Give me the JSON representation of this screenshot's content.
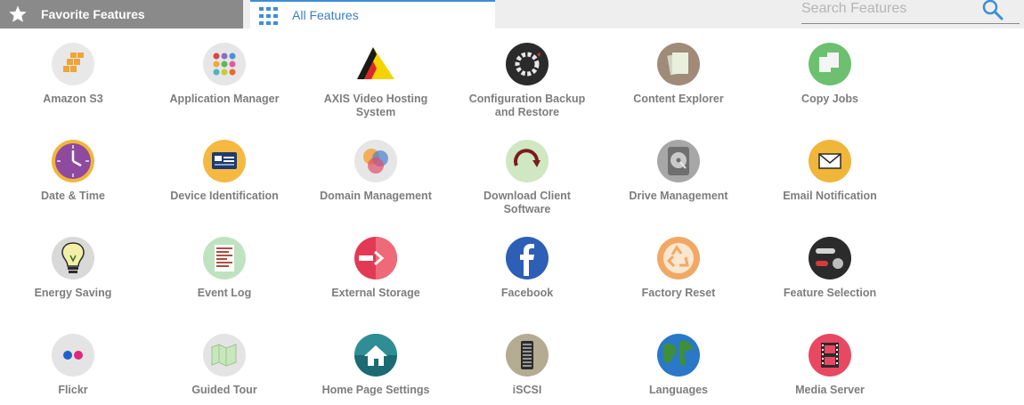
{
  "tabs": {
    "favorite_label": "Favorite Features",
    "all_label": "All Features"
  },
  "search": {
    "placeholder": "Search Features"
  },
  "features": [
    {
      "label": "Amazon S3",
      "icon": "amazon-s3-icon"
    },
    {
      "label": "Application Manager",
      "icon": "application-manager-icon"
    },
    {
      "label": "AXIS Video Hosting System",
      "icon": "axis-logo-icon"
    },
    {
      "label": "Configuration Backup and Restore",
      "icon": "backup-gear-icon"
    },
    {
      "label": "Content Explorer",
      "icon": "content-explorer-icon"
    },
    {
      "label": "Copy Jobs",
      "icon": "copy-jobs-icon"
    },
    {
      "label": "Date & Time",
      "icon": "clock-icon"
    },
    {
      "label": "Device Identification",
      "icon": "device-id-icon"
    },
    {
      "label": "Domain Management",
      "icon": "domain-circles-icon"
    },
    {
      "label": "Download Client Software",
      "icon": "download-arrow-icon"
    },
    {
      "label": "Drive Management",
      "icon": "hard-drive-icon"
    },
    {
      "label": "Email Notification",
      "icon": "envelope-icon"
    },
    {
      "label": "Energy Saving",
      "icon": "lightbulb-icon"
    },
    {
      "label": "Event Log",
      "icon": "event-log-icon"
    },
    {
      "label": "External Storage",
      "icon": "external-storage-icon"
    },
    {
      "label": "Facebook",
      "icon": "facebook-icon"
    },
    {
      "label": "Factory Reset",
      "icon": "recycle-icon"
    },
    {
      "label": "Feature Selection",
      "icon": "feature-toggle-icon"
    },
    {
      "label": "Flickr",
      "icon": "flickr-icon"
    },
    {
      "label": "Guided Tour",
      "icon": "map-icon"
    },
    {
      "label": "Home Page Settings",
      "icon": "home-icon"
    },
    {
      "label": "iSCSI",
      "icon": "iscsi-server-icon"
    },
    {
      "label": "Languages",
      "icon": "globe-icon"
    },
    {
      "label": "Media Server",
      "icon": "film-strip-icon"
    }
  ],
  "colors": {
    "tab_active_accent": "#3a8fd6",
    "tab_fav_bg": "#8a8a8a",
    "label_gray": "#7d7d7d"
  }
}
